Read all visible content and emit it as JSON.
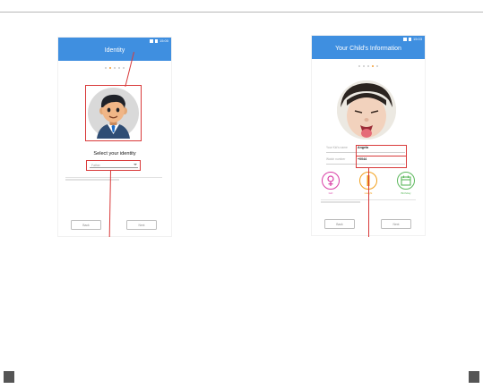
{
  "screen1": {
    "status_time": "15:00",
    "title": "Identity",
    "step_dots": 5,
    "active_step": 1,
    "avatar_icon": "father-avatar-icon",
    "select_prompt": "Select your identity",
    "select_value": "Father",
    "back_label": "Back",
    "next_label": "Next"
  },
  "screen2": {
    "status_time": "15:03",
    "title": "Your Child's Information",
    "step_dots": 5,
    "active_step": 4,
    "photo": "child-photo",
    "name_label": "Your Kid's name",
    "name_value": "Angela",
    "watch_label": "Watch number",
    "watch_value": "+0044",
    "options": [
      {
        "icon": "female-icon",
        "label": "Girl",
        "color": "#d93fa6"
      },
      {
        "icon": "height-icon",
        "label": "Height",
        "color": "#f2a11e"
      },
      {
        "icon": "birthday-calendar-icon",
        "label": "Birthday",
        "color": "#5cb85c"
      }
    ],
    "back_label": "Back",
    "next_label": "Next"
  },
  "colors": {
    "app_bar": "#3f8fe0",
    "highlight": "#d93a3a",
    "page_marker": "#555555"
  }
}
